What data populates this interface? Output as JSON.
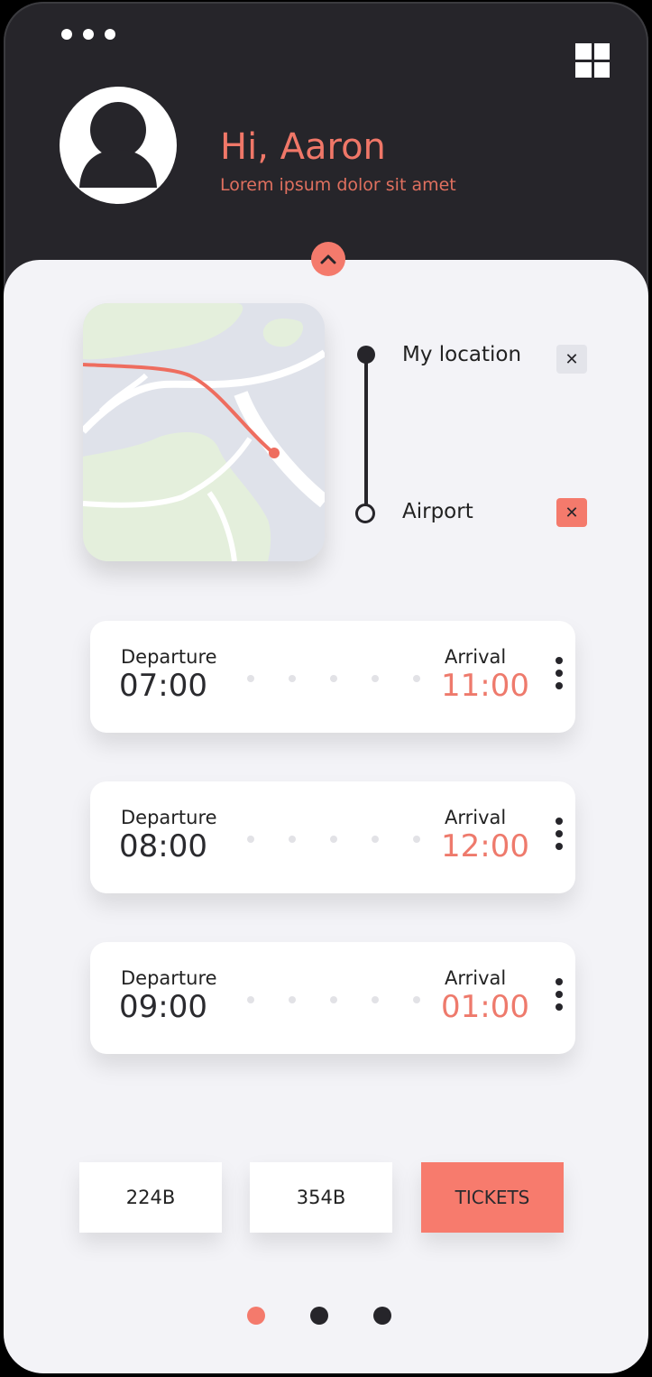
{
  "header": {
    "greeting": "Hi, Aaron",
    "subtitle": "Lorem ipsum dolor sit amet"
  },
  "route": {
    "origin": "My location",
    "destination": "Airport"
  },
  "flights": [
    {
      "departure_label": "Departure",
      "departure_time": "07:00",
      "arrival_label": "Arrival",
      "arrival_time": "11:00"
    },
    {
      "departure_label": "Departure",
      "departure_time": "08:00",
      "arrival_label": "Arrival",
      "arrival_time": "12:00"
    },
    {
      "departure_label": "Departure",
      "departure_time": "09:00",
      "arrival_label": "Arrival",
      "arrival_time": "01:00"
    }
  ],
  "actions": {
    "seat_1": "224B",
    "seat_2": "354B",
    "tickets": "TICKETS"
  },
  "colors": {
    "accent": "#f47a6c",
    "dark": "#26252a",
    "panel": "#f3f3f7"
  },
  "pager": {
    "active_index": 0,
    "count": 3
  }
}
